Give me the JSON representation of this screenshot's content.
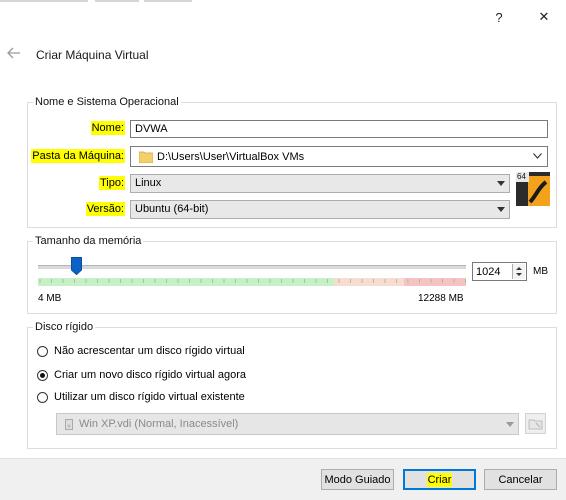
{
  "window": {
    "help_glyph": "?",
    "close_glyph": "✕",
    "title": "Criar Máquina Virtual"
  },
  "name_os": {
    "legend": "Nome e Sistema Operacional",
    "name_label": "Nome:",
    "name_value": "DVWA",
    "folder_label": "Pasta da Máquina:",
    "folder_value": "D:\\Users\\User\\VirtualBox VMs",
    "type_label": "Tipo:",
    "type_value": "Linux",
    "version_label": "Versão:",
    "version_value": "Ubuntu (64-bit)",
    "os_badge": "64",
    "highlight_color": "#ffff00"
  },
  "memory": {
    "legend": "Tamanho da memória",
    "value": "1024",
    "unit": "MB",
    "min_label": "4 MB",
    "max_label": "12288 MB",
    "slider_fraction": 0.08
  },
  "disk": {
    "legend": "Disco rígido",
    "options": [
      "Não acrescentar um disco rígido virtual",
      "Criar um novo disco rígido virtual agora",
      "Utilizar um disco rígido virtual existente"
    ],
    "selected_index": 1,
    "existing_file": "Win XP.vdi (Normal, Inacessível)"
  },
  "buttons": {
    "guided": "Modo Guiado",
    "create": "Criar",
    "cancel": "Cancelar"
  }
}
